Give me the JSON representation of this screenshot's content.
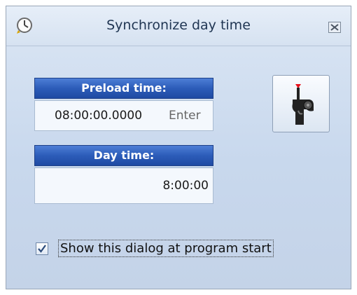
{
  "window": {
    "title": "Synchronize day time",
    "title_icon": "clock-icon",
    "close_icon": "close-icon"
  },
  "preload": {
    "header": "Preload time:",
    "value": "08:00:00.0000",
    "hint": "Enter"
  },
  "day_time": {
    "header": "Day time:",
    "value": "8:00:00"
  },
  "sync_button": {
    "icon": "starter-pistol-icon"
  },
  "startup": {
    "label": "Show this dialog at program start",
    "checked": true
  },
  "colors": {
    "header_blue": "#2c5cb9",
    "window_bg": "#c8d8ed"
  }
}
